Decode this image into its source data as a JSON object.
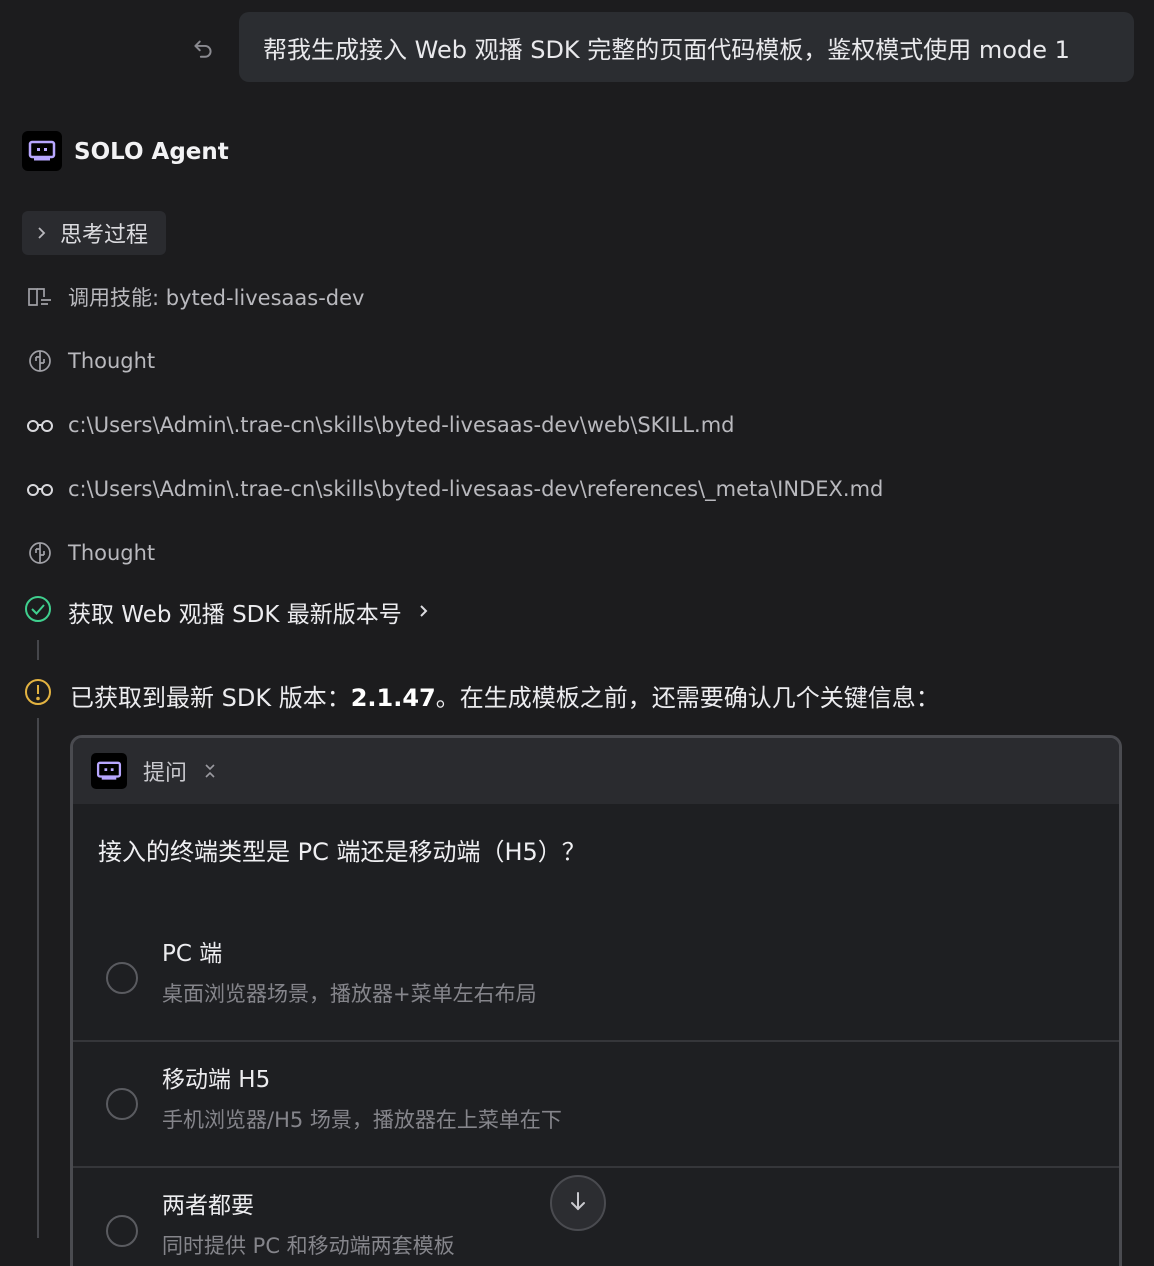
{
  "user_message": "帮我生成接入 Web 观播 SDK 完整的页面代码模板，鉴权模式使用 mode 1",
  "agent": {
    "name": "SOLO Agent"
  },
  "thinking_chip": "思考过程",
  "steps": [
    {
      "icon": "book-icon",
      "text": "调用技能: byted-livesaas-dev"
    },
    {
      "icon": "brain-icon",
      "text": "Thought"
    },
    {
      "icon": "glasses-icon",
      "text": "c:\\Users\\Admin\\.trae-cn\\skills\\byted-livesaas-dev\\web\\SKILL.md"
    },
    {
      "icon": "glasses-icon",
      "text": "c:\\Users\\Admin\\.trae-cn\\skills\\byted-livesaas-dev\\references\\_meta\\INDEX.md"
    },
    {
      "icon": "brain-icon",
      "text": "Thought"
    }
  ],
  "task": {
    "title": "获取 Web 观播 SDK 最新版本号",
    "status_color": "#3fcf8e"
  },
  "info": {
    "prefix": "已获取到最新 SDK 版本：",
    "version": "2.1.47",
    "suffix": "。在生成模板之前，还需要确认几个关键信息：",
    "icon_color": "#e3b341"
  },
  "question_card": {
    "title": "提问",
    "question": "接入的终端类型是 PC 端还是移动端（H5）？",
    "options": [
      {
        "title": "PC 端",
        "desc": "桌面浏览器场景，播放器+菜单左右布局"
      },
      {
        "title": "移动端 H5",
        "desc": "手机浏览器/H5 场景，播放器在上菜单在下"
      },
      {
        "title": "两者都要",
        "desc": "同时提供 PC 和移动端两套模板"
      }
    ]
  }
}
